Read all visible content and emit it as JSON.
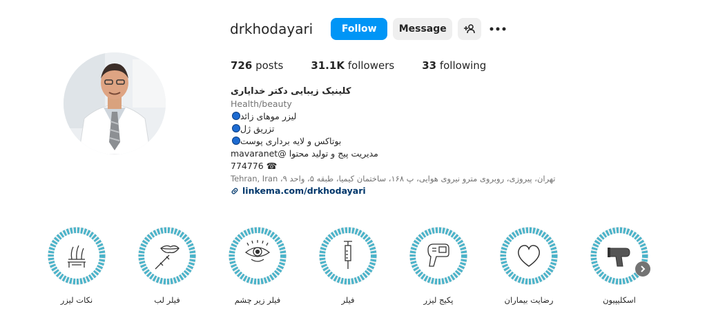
{
  "profile": {
    "username": "drkhodayari",
    "follow_label": "Follow",
    "message_label": "Message",
    "stats": {
      "posts_count": "726",
      "posts_label": "posts",
      "followers_count": "31.1K",
      "followers_label": "followers",
      "following_count": "33",
      "following_label": "following"
    }
  },
  "bio": {
    "name": "کلینیک زیبایی دکتر خدایاری",
    "category": "Health/beauty",
    "line1": "لیزر موهای زائد",
    "line2": "تزریق ژل",
    "line3": "بوتاکس و لایه برداری پوست",
    "line4": "مدیریت پیج و تولید محتوا @mavaranet",
    "phone": "774776",
    "address": "تهران، پیروزی، روبروی مترو نیروی هوایی، پ ۱۶۸، ساختمان کیمیا، طبقه ۵، واحد ۹، Tehran, Iran",
    "link": "linkema.com/drkhodayari"
  },
  "highlights": [
    {
      "label": "نکات لیزر",
      "icon": "laser-hair-icon"
    },
    {
      "label": "فیلر لب",
      "icon": "lip-filler-icon"
    },
    {
      "label": "فیلر زیر چشم",
      "icon": "eye-icon"
    },
    {
      "label": "فیلر",
      "icon": "syringe-icon"
    },
    {
      "label": "پکیج لیزر",
      "icon": "laser-device-icon"
    },
    {
      "label": "رضایت بیماران",
      "icon": "heart-icon"
    },
    {
      "label": "اسکلیپیون",
      "icon": "hair-dryer-icon"
    }
  ],
  "colors": {
    "follow_button": "#0095f6",
    "secondary_button": "#efefef",
    "link": "#00376b",
    "highlight_ring": "#4bb3c9"
  }
}
